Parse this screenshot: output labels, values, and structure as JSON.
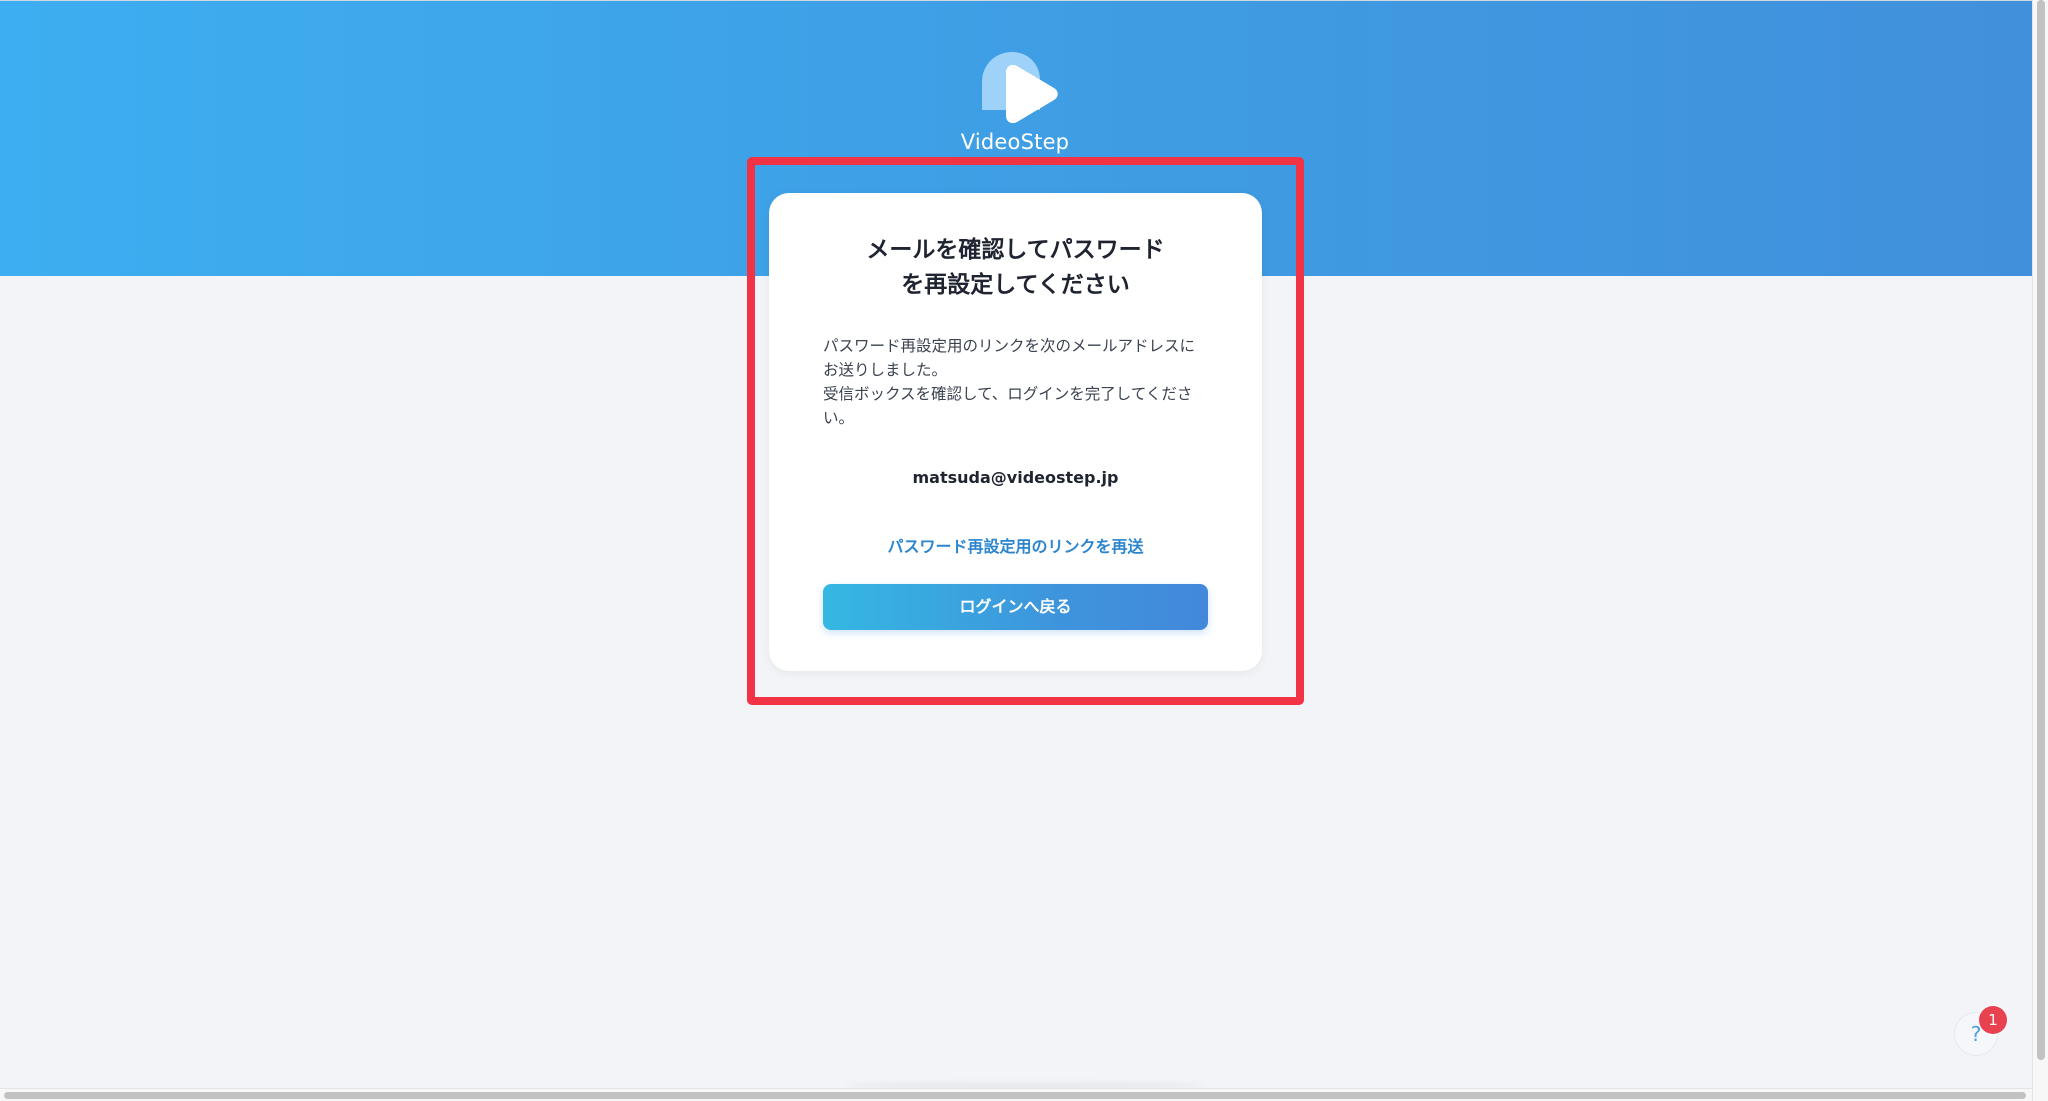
{
  "brand": {
    "logo_text": "VideoStep"
  },
  "card": {
    "title_line1": "メールを確認してパスワード",
    "title_line2": "を再設定してください",
    "body_lines": [
      "パスワード再設定用のリンクを次のメールアドレスに",
      "お送りしました。",
      "受信ボックスを確認して、ログインを完了してくださ",
      "い。"
    ],
    "email": "matsuda@videostep.jp",
    "resend_link": "パスワード再設定用のリンクを再送",
    "back_button": "ログインへ戻る"
  },
  "help_widget": {
    "icon": "question-icon",
    "icon_glyph": "?",
    "badge_count": "1"
  },
  "colors": {
    "hero_gradient_start": "#3daef1",
    "hero_gradient_end": "#4190dc",
    "highlight_frame": "#f23245",
    "link": "#2c86cf",
    "badge": "#e8414f"
  }
}
